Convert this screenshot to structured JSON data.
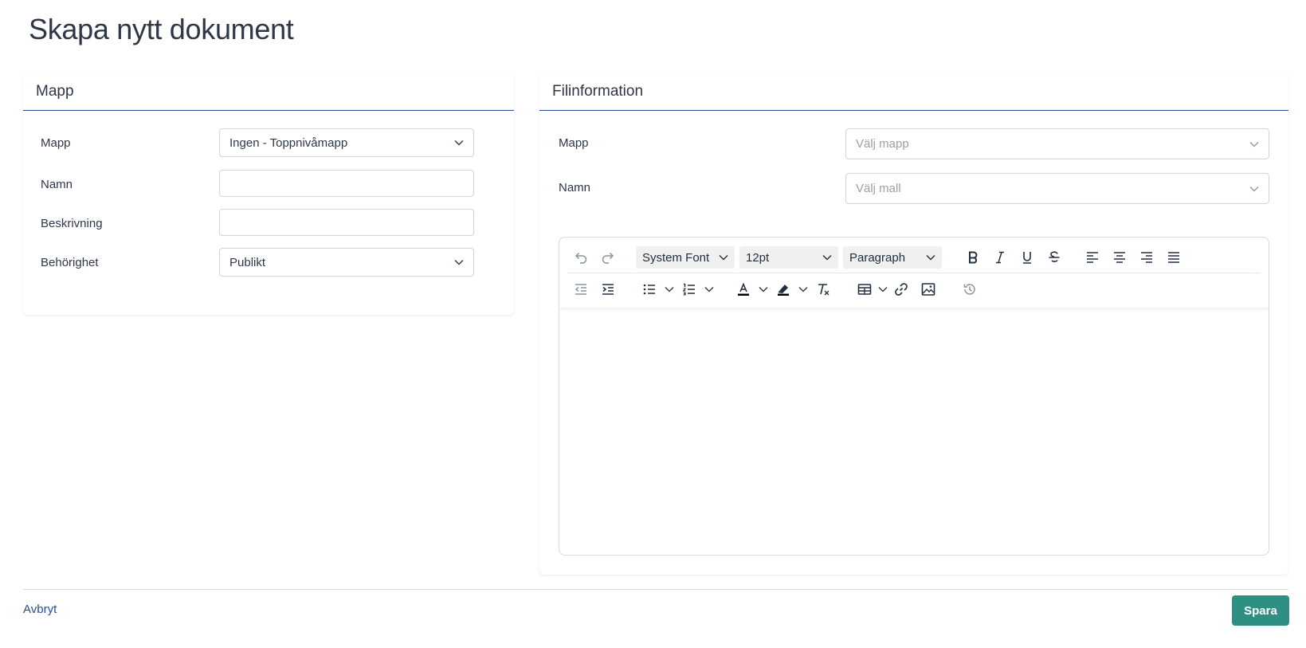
{
  "page": {
    "title": "Skapa nytt dokument"
  },
  "folder_card": {
    "header": "Mapp",
    "fields": {
      "folder": {
        "label": "Mapp",
        "value": "Ingen - Toppnivåmapp"
      },
      "name": {
        "label": "Namn",
        "value": ""
      },
      "description": {
        "label": "Beskrivning",
        "value": ""
      },
      "permission": {
        "label": "Behörighet",
        "value": "Publikt"
      }
    }
  },
  "file_card": {
    "header": "Filinformation",
    "fields": {
      "folder": {
        "label": "Mapp",
        "placeholder": "Välj mapp"
      },
      "name": {
        "label": "Namn",
        "placeholder": "Välj mall"
      }
    },
    "editor": {
      "font_family": "System Font",
      "font_size": "12pt",
      "block_format": "Paragraph",
      "content": ""
    }
  },
  "footer": {
    "cancel_label": "Avbryt",
    "save_label": "Spara"
  },
  "colors": {
    "accent": "#2b4c9b",
    "save_button": "#2f8f83"
  }
}
